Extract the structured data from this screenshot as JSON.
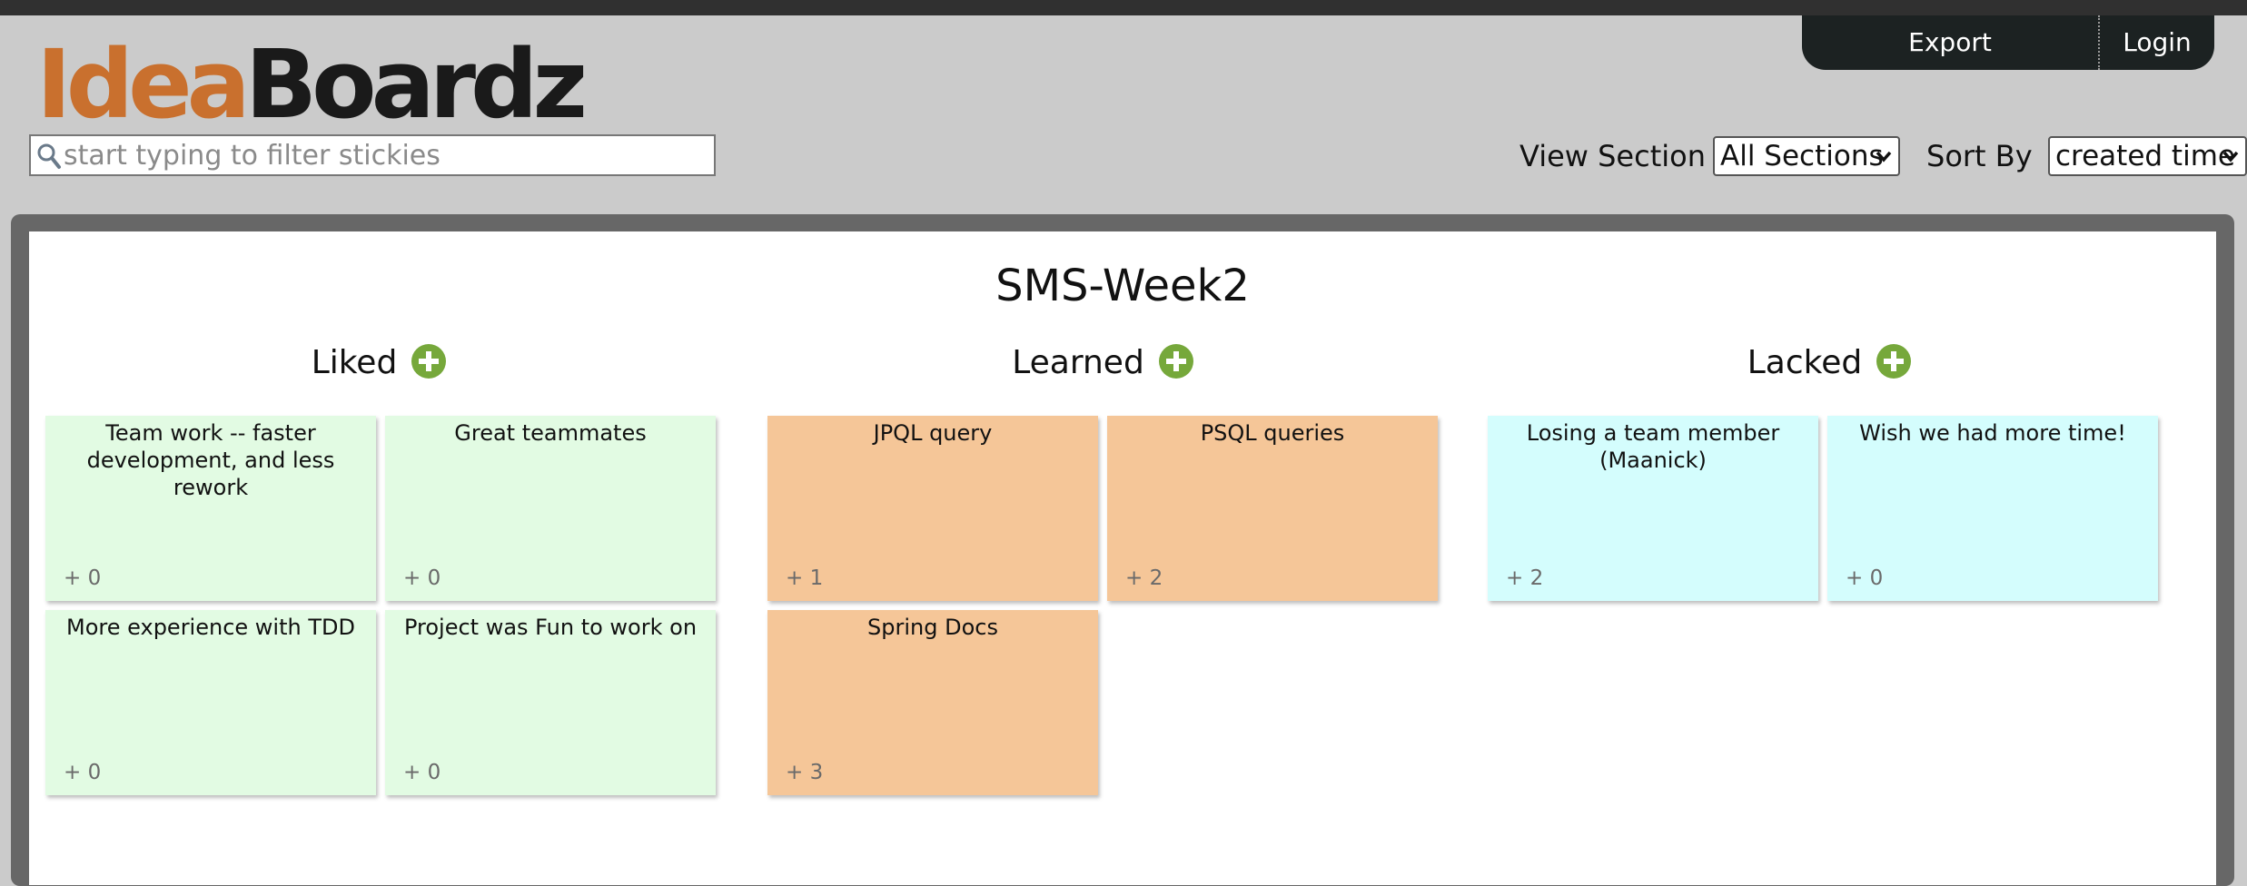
{
  "nav": {
    "export_label": "Export",
    "login_label": "Login"
  },
  "logo": {
    "part1": "Idea",
    "part2": "Boardz"
  },
  "filter": {
    "placeholder": "start typing to filter stickies",
    "value": ""
  },
  "controls": {
    "view_section_label": "View Section",
    "view_section_value": "All Sections",
    "sort_by_label": "Sort By",
    "sort_by_value": "created time"
  },
  "board": {
    "title": "SMS-Week2",
    "sections": [
      {
        "name": "Liked",
        "color": "#e2fbe3",
        "stickies": [
          {
            "text": "Team work -- faster development, and less rework",
            "votes": "+ 0"
          },
          {
            "text": "Great teammates",
            "votes": "+ 0"
          },
          {
            "text": "More experience with TDD",
            "votes": "+ 0"
          },
          {
            "text": "Project was Fun to work on",
            "votes": "+ 0"
          }
        ]
      },
      {
        "name": "Learned",
        "color": "#f5c698",
        "stickies": [
          {
            "text": "JPQL query",
            "votes": "+ 1"
          },
          {
            "text": "PSQL queries",
            "votes": "+ 2"
          },
          {
            "text": "Spring Docs",
            "votes": "+ 3"
          }
        ]
      },
      {
        "name": "Lacked",
        "color": "#d4fdfd",
        "stickies": [
          {
            "text": "Losing a team member (Maanick)",
            "votes": "+ 2"
          },
          {
            "text": "Wish we had more time!",
            "votes": "+ 0"
          }
        ]
      }
    ]
  },
  "icons": {
    "search": "search-icon",
    "add": "plus-circle-icon",
    "dropdown": "chevron-down-icon"
  }
}
